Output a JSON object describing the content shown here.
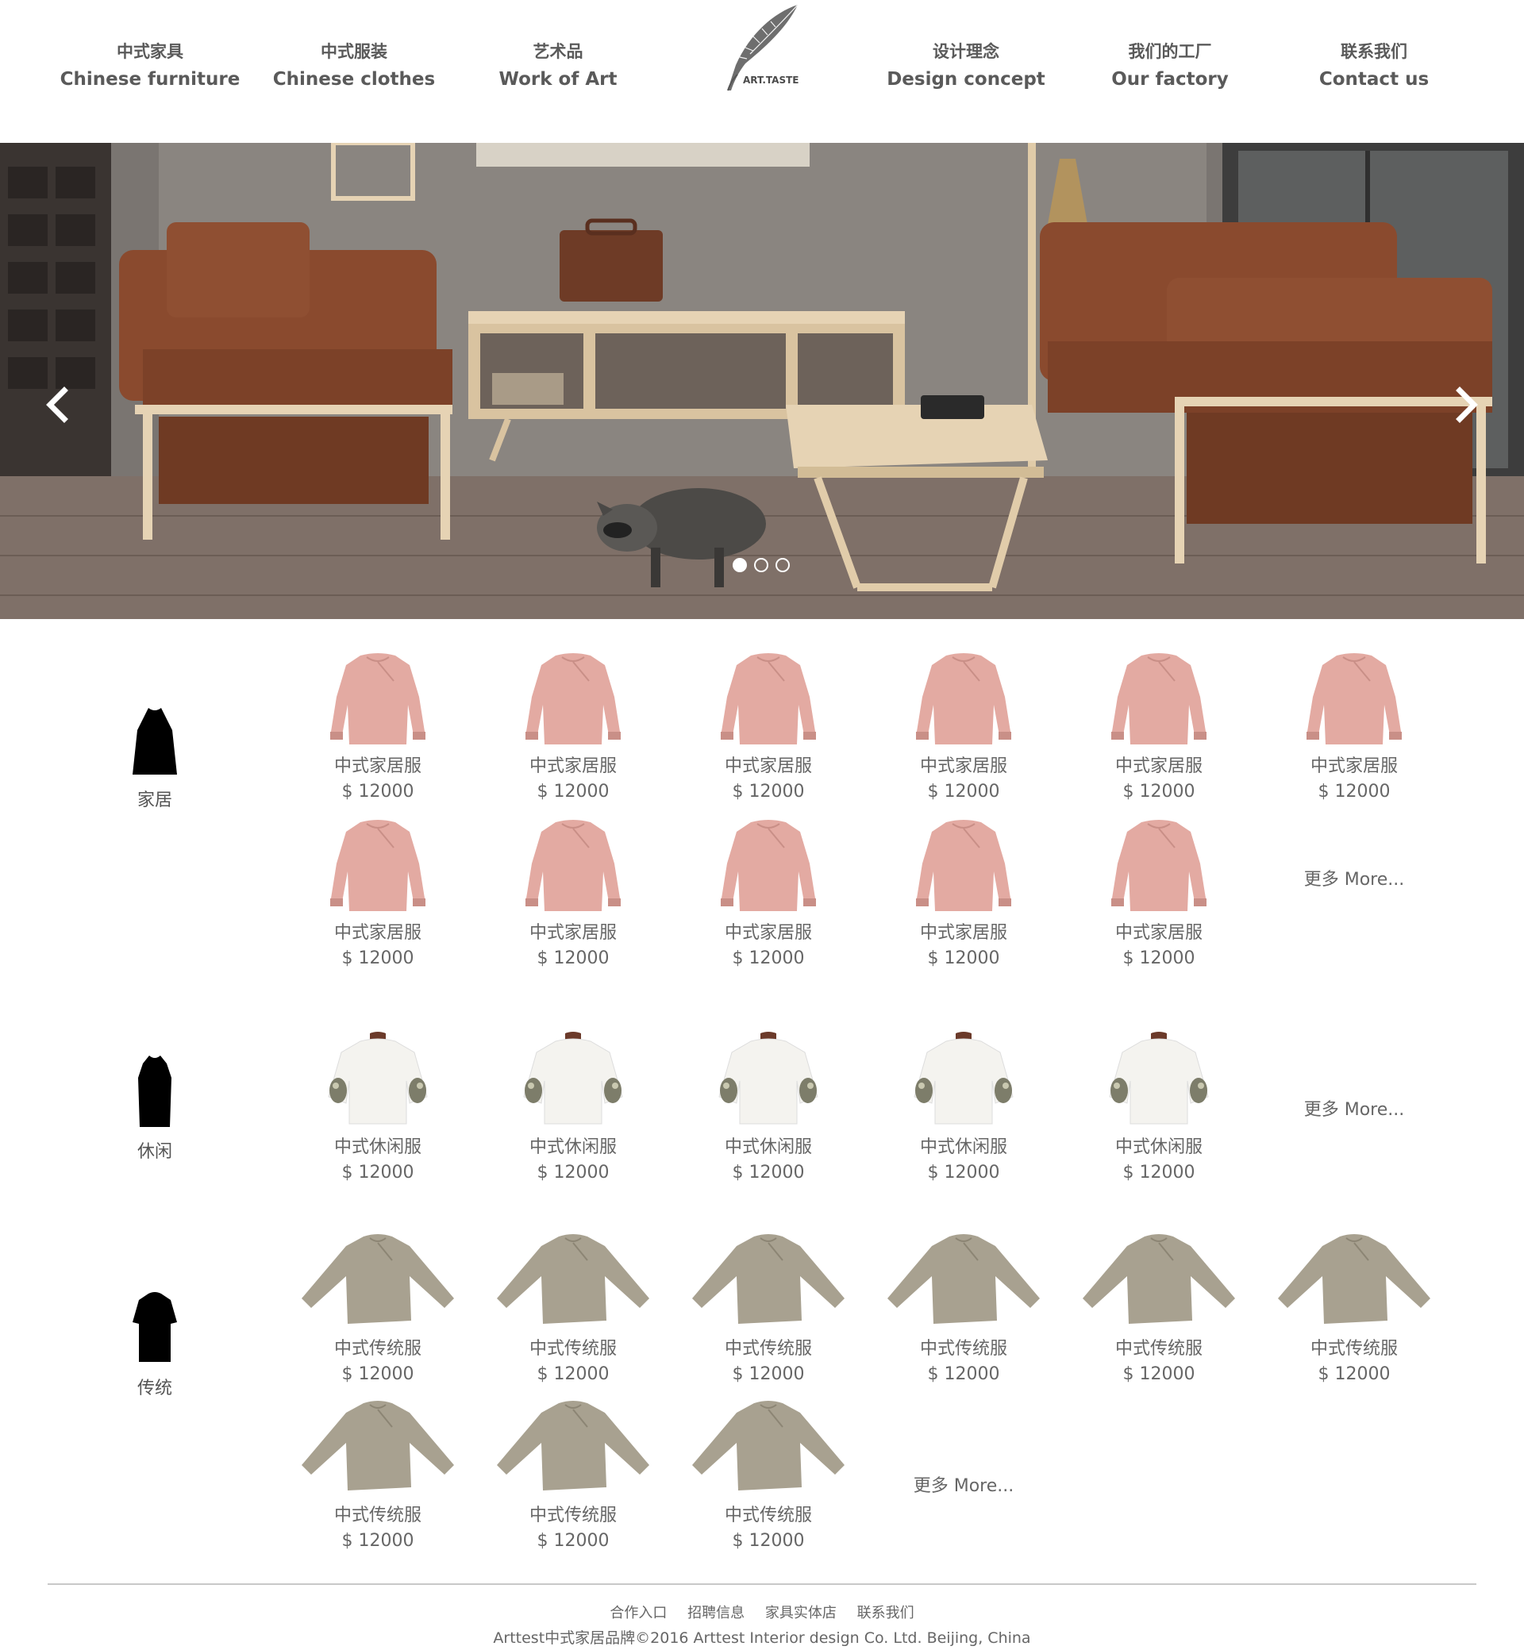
{
  "nav": {
    "items": [
      {
        "cn": "中式家具",
        "en": "Chinese furniture"
      },
      {
        "cn": "中式服装",
        "en": "Chinese clothes"
      },
      {
        "cn": "艺术品",
        "en": "Work of Art"
      },
      {
        "cn": "设计理念",
        "en": "Design concept"
      },
      {
        "cn": "我们的工厂",
        "en": "Our factory"
      },
      {
        "cn": "联系我们",
        "en": "Contact us"
      }
    ],
    "logo_text": "ART.TASTE",
    "logo_icon": "feather-icon"
  },
  "banner": {
    "prev_icon": "chevron-left-icon",
    "next_icon": "chevron-right-icon",
    "slide_count": 3,
    "active_slide": 1
  },
  "sections": [
    {
      "category": "家居",
      "products": [
        {
          "name": "中式家居服",
          "price": "$ 12000"
        },
        {
          "name": "中式家居服",
          "price": "$ 12000"
        },
        {
          "name": "中式家居服",
          "price": "$ 12000"
        },
        {
          "name": "中式家居服",
          "price": "$ 12000"
        },
        {
          "name": "中式家居服",
          "price": "$ 12000"
        },
        {
          "name": "中式家居服",
          "price": "$ 12000"
        },
        {
          "name": "中式家居服",
          "price": "$ 12000"
        },
        {
          "name": "中式家居服",
          "price": "$ 12000"
        },
        {
          "name": "中式家居服",
          "price": "$ 12000"
        },
        {
          "name": "中式家居服",
          "price": "$ 12000"
        },
        {
          "name": "中式家居服",
          "price": "$ 12000"
        }
      ],
      "more": "更多 More..."
    },
    {
      "category": "休闲",
      "products": [
        {
          "name": "中式休闲服",
          "price": "$ 12000"
        },
        {
          "name": "中式休闲服",
          "price": "$ 12000"
        },
        {
          "name": "中式休闲服",
          "price": "$ 12000"
        },
        {
          "name": "中式休闲服",
          "price": "$ 12000"
        },
        {
          "name": "中式休闲服",
          "price": "$ 12000"
        }
      ],
      "more": "更多 More..."
    },
    {
      "category": "传统",
      "products": [
        {
          "name": "中式传统服",
          "price": "$ 12000"
        },
        {
          "name": "中式传统服",
          "price": "$ 12000"
        },
        {
          "name": "中式传统服",
          "price": "$ 12000"
        },
        {
          "name": "中式传统服",
          "price": "$ 12000"
        },
        {
          "name": "中式传统服",
          "price": "$ 12000"
        },
        {
          "name": "中式传统服",
          "price": "$ 12000"
        },
        {
          "name": "中式传统服",
          "price": "$ 12000"
        },
        {
          "name": "中式传统服",
          "price": "$ 12000"
        },
        {
          "name": "中式传统服",
          "price": "$ 12000"
        }
      ],
      "more": "更多 More..."
    }
  ],
  "footer": {
    "links": [
      "合作入口",
      "招聘信息",
      "家具实体店",
      "联系我们"
    ],
    "copyright": "Arttest中式家居品牌©2016 Arttest Interior design Co. Ltd. Beijing, China"
  },
  "colors": {
    "pink_garment": "#e3aaa2",
    "white_garment": "#f4f3ef",
    "grey_garment": "#a8a190",
    "sofa_brown": "#8a4a2e",
    "wood": "#e6d3b4"
  }
}
